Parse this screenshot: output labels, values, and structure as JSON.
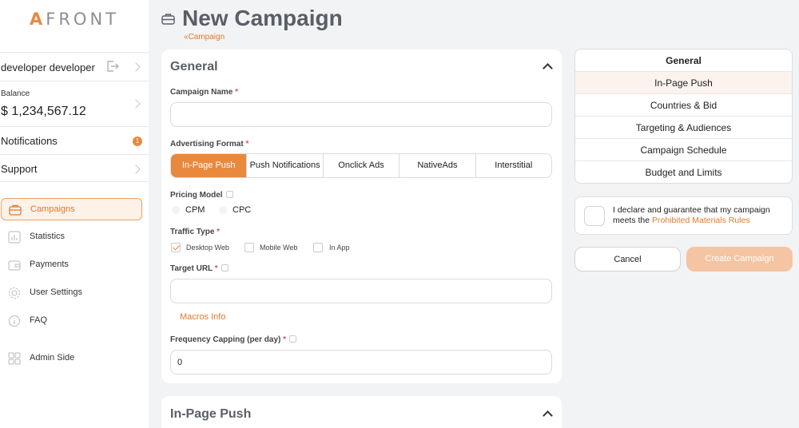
{
  "logo": {
    "text_a": "A",
    "text_rest": "FRONT"
  },
  "sidebar": {
    "user_name": "developer developer",
    "balance_label": "Balance",
    "balance_value": "$ 1,234,567.12",
    "notifications_label": "Notifications",
    "notifications_count": "1",
    "support_label": "Support",
    "nav": [
      {
        "label": "Campaigns",
        "icon": "briefcase-icon",
        "active": true
      },
      {
        "label": "Statistics",
        "icon": "bar-chart-icon"
      },
      {
        "label": "Payments",
        "icon": "wallet-icon"
      },
      {
        "label": "User Settings",
        "icon": "gear-icon"
      },
      {
        "label": "FAQ",
        "icon": "info-icon"
      },
      {
        "label": "Admin Side",
        "icon": "grid-icon"
      }
    ]
  },
  "page": {
    "title": "New Campaign",
    "breadcrumb": "Campaign"
  },
  "general": {
    "title": "General",
    "campaign_name_label": "Campaign Name",
    "campaign_name_value": "",
    "format_label": "Advertising Format",
    "formats": [
      "In-Page Push",
      "Push Notifications",
      "Onclick Ads",
      "NativeAds",
      "Interstitial"
    ],
    "selected_format": "In-Page Push",
    "pricing_label": "Pricing Model",
    "pricing_options": [
      "CPM",
      "CPC"
    ],
    "traffic_label": "Traffic Type",
    "traffic_options": [
      {
        "label": "Desktop Web",
        "checked": true
      },
      {
        "label": "Mobile Web",
        "checked": false
      },
      {
        "label": "In App",
        "checked": false
      }
    ],
    "target_url_label": "Target URL",
    "target_url_value": "",
    "macros_link": "Macros Info",
    "freq_label": "Frequency Capping (per day)",
    "freq_value": "0"
  },
  "inpage": {
    "title": "In-Page Push"
  },
  "steps": {
    "header": "General",
    "items": [
      "In-Page Push",
      "Countries & Bid",
      "Targeting & Audiences",
      "Campaign Schedule",
      "Budget and Limits"
    ]
  },
  "declaration": {
    "text": "I declare and guarantee that my campaign meets the",
    "link": "Prohibited Materials Rules"
  },
  "actions": {
    "cancel": "Cancel",
    "create": "Create Campaign"
  },
  "colors": {
    "accent": "#e8893e",
    "create_disabled": "#f5c4a2"
  }
}
